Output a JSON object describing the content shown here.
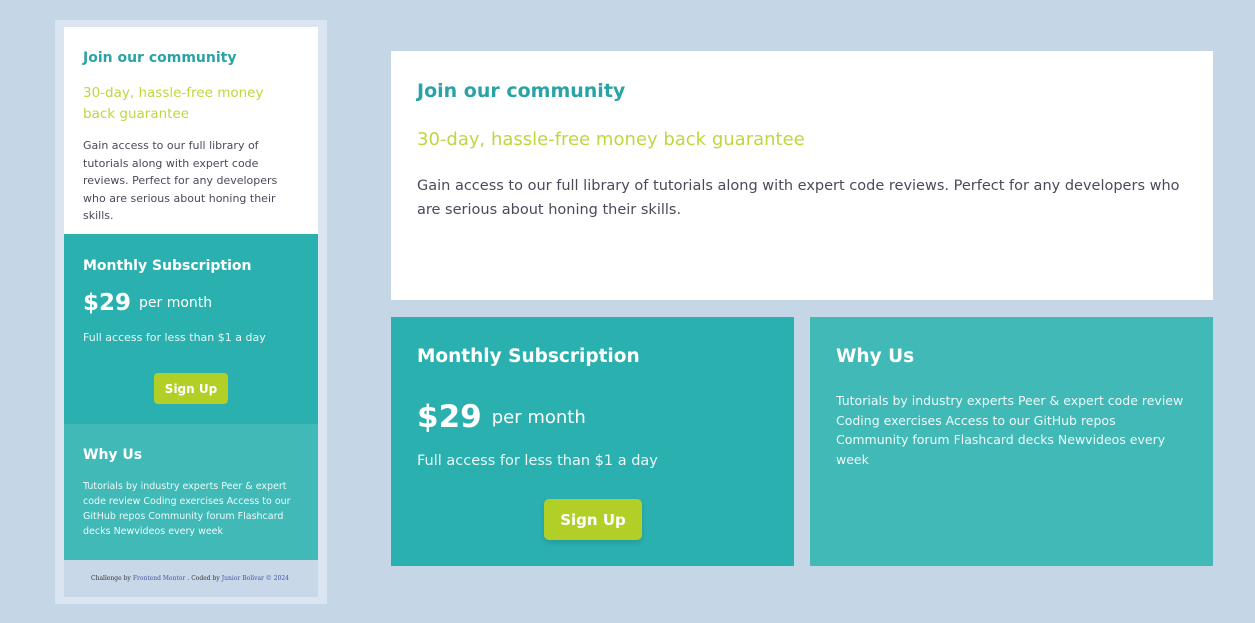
{
  "mobile": {
    "title": "Join our community",
    "guarantee": "30-day, hassle-free money back guarantee",
    "description": "Gain access to our full library of tutorials along with expert code reviews. Perfect for any developers who are serious about honing their skills.",
    "subscription": {
      "heading": "Monthly Subscription",
      "price": "$29",
      "period": "per month",
      "note": "Full access for less than $1 a day",
      "button": "Sign Up"
    },
    "why": {
      "heading": "Why Us",
      "list": "Tutorials by industry experts Peer & expert code review Coding exercises Access to our GitHub repos Community forum Flashcard decks Newvideos every week"
    },
    "attribution": {
      "prefix": "Challenge by",
      "fm_link": "Frontend Mentor",
      "coded_by": ". Coded by",
      "author_link": "Junior Bolívar © 2024"
    }
  },
  "desktop": {
    "title": "Join our community",
    "guarantee": "30-day, hassle-free money back guarantee",
    "description": "Gain access to our full library of tutorials along with expert code reviews. Perfect for any developers who are serious about honing their skills.",
    "subscription": {
      "heading": "Monthly Subscription",
      "price": "$29",
      "period": "per month",
      "note": "Full access for less than $1 a day",
      "button": "Sign Up"
    },
    "why": {
      "heading": "Why Us",
      "list": "Tutorials by industry experts Peer & expert code review Coding exercises Access to our GitHub repos Community forum Flashcard decks Newvideos every week"
    }
  },
  "colors": {
    "background": "#c5d6e6",
    "teal_dark": "#2bb0b0",
    "teal_light": "#40b9b7",
    "heading_teal": "#2aa3a5",
    "lime": "#bfd73f",
    "button": "#b1cf27"
  }
}
